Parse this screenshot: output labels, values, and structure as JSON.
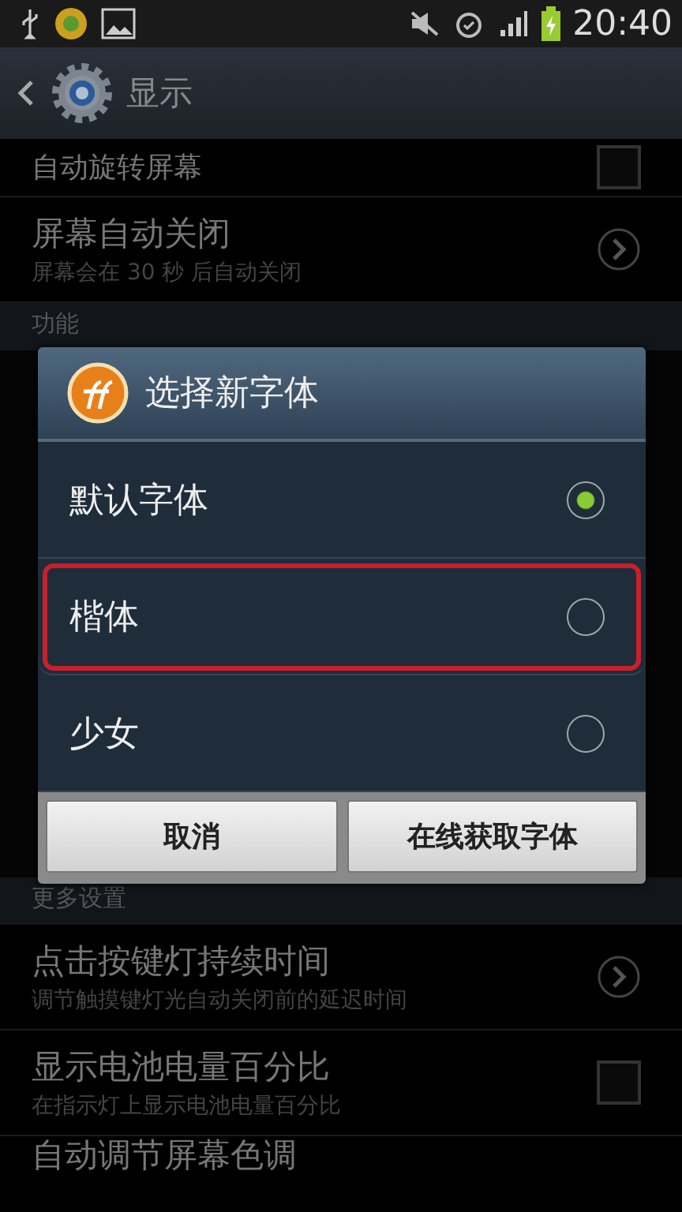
{
  "status_bar": {
    "time": "20:40"
  },
  "action_bar": {
    "title": "显示"
  },
  "settings": [
    {
      "kind": "checkbox",
      "title": "自动旋转屏幕",
      "checked": false
    },
    {
      "kind": "link",
      "title": "屏幕自动关闭",
      "subtitle": "屏幕会在 30 秒 后自动关闭"
    },
    {
      "kind": "header",
      "title": "功能"
    },
    {
      "kind": "gap"
    },
    {
      "kind": "header",
      "title": "更多设置"
    },
    {
      "kind": "link",
      "title": "点击按键灯持续时间",
      "subtitle": "调节触摸键灯光自动关闭前的延迟时间"
    },
    {
      "kind": "checkbox",
      "title": "显示电池电量百分比",
      "subtitle": "在指示灯上显示电池电量百分比",
      "checked": false
    },
    {
      "kind": "partial",
      "title": "自动调节屏幕色调"
    }
  ],
  "dialog": {
    "title": "选择新字体",
    "options": [
      {
        "label": "默认字体",
        "selected": true,
        "highlighted": false
      },
      {
        "label": "楷体",
        "selected": false,
        "highlighted": true
      },
      {
        "label": "少女",
        "selected": false,
        "highlighted": false
      }
    ],
    "buttons": [
      "取消",
      "在线获取字体"
    ]
  }
}
